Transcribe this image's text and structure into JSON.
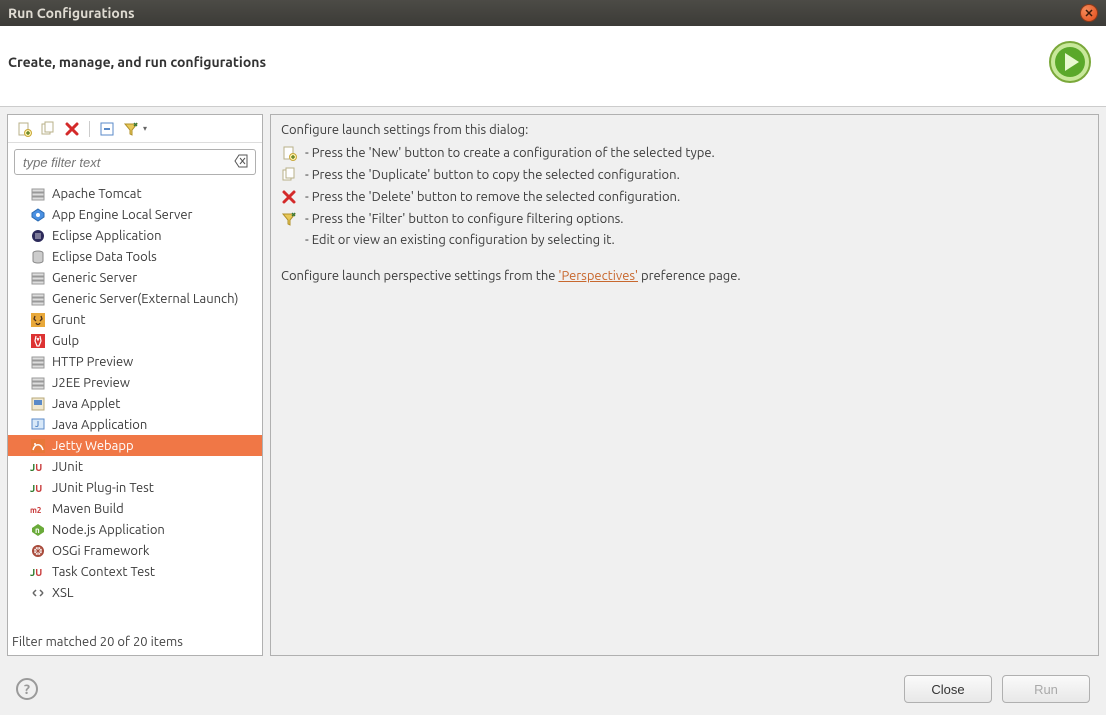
{
  "window": {
    "title": "Run Configurations"
  },
  "header": {
    "title": "Create, manage, and run configurations"
  },
  "filter": {
    "placeholder": "type filter text"
  },
  "tree": {
    "items": [
      {
        "label": "Apache Tomcat",
        "icon": "tomcat"
      },
      {
        "label": "App Engine Local Server",
        "icon": "appengine"
      },
      {
        "label": "Eclipse Application",
        "icon": "eclipse"
      },
      {
        "label": "Eclipse Data Tools",
        "icon": "datatools"
      },
      {
        "label": "Generic Server",
        "icon": "genserver"
      },
      {
        "label": "Generic Server(External Launch)",
        "icon": "genserver"
      },
      {
        "label": "Grunt",
        "icon": "grunt"
      },
      {
        "label": "Gulp",
        "icon": "gulp"
      },
      {
        "label": "HTTP Preview",
        "icon": "genserver"
      },
      {
        "label": "J2EE Preview",
        "icon": "genserver"
      },
      {
        "label": "Java Applet",
        "icon": "applet"
      },
      {
        "label": "Java Application",
        "icon": "javaapp"
      },
      {
        "label": "Jetty Webapp",
        "icon": "jetty",
        "selected": true
      },
      {
        "label": "JUnit",
        "icon": "junit"
      },
      {
        "label": "JUnit Plug-in Test",
        "icon": "junit"
      },
      {
        "label": "Maven Build",
        "icon": "maven"
      },
      {
        "label": "Node.js Application",
        "icon": "node"
      },
      {
        "label": "OSGi Framework",
        "icon": "osgi"
      },
      {
        "label": "Task Context Test",
        "icon": "junit"
      },
      {
        "label": "XSL",
        "icon": "xsl"
      }
    ]
  },
  "status": {
    "text": "Filter matched 20 of 20 items"
  },
  "instructions": {
    "heading": "Configure launch settings from this dialog:",
    "new": "- Press the 'New' button to create a configuration of the selected type.",
    "duplicate": "- Press the 'Duplicate' button to copy the selected configuration.",
    "delete": "- Press the 'Delete' button to remove the selected configuration.",
    "filter": "- Press the 'Filter' button to configure filtering options.",
    "edit": "- Edit or view an existing configuration by selecting it.",
    "perspective_pre": "Configure launch perspective settings from the ",
    "perspective_link": "'Perspectives'",
    "perspective_post": " preference page."
  },
  "buttons": {
    "close": "Close",
    "run": "Run"
  }
}
